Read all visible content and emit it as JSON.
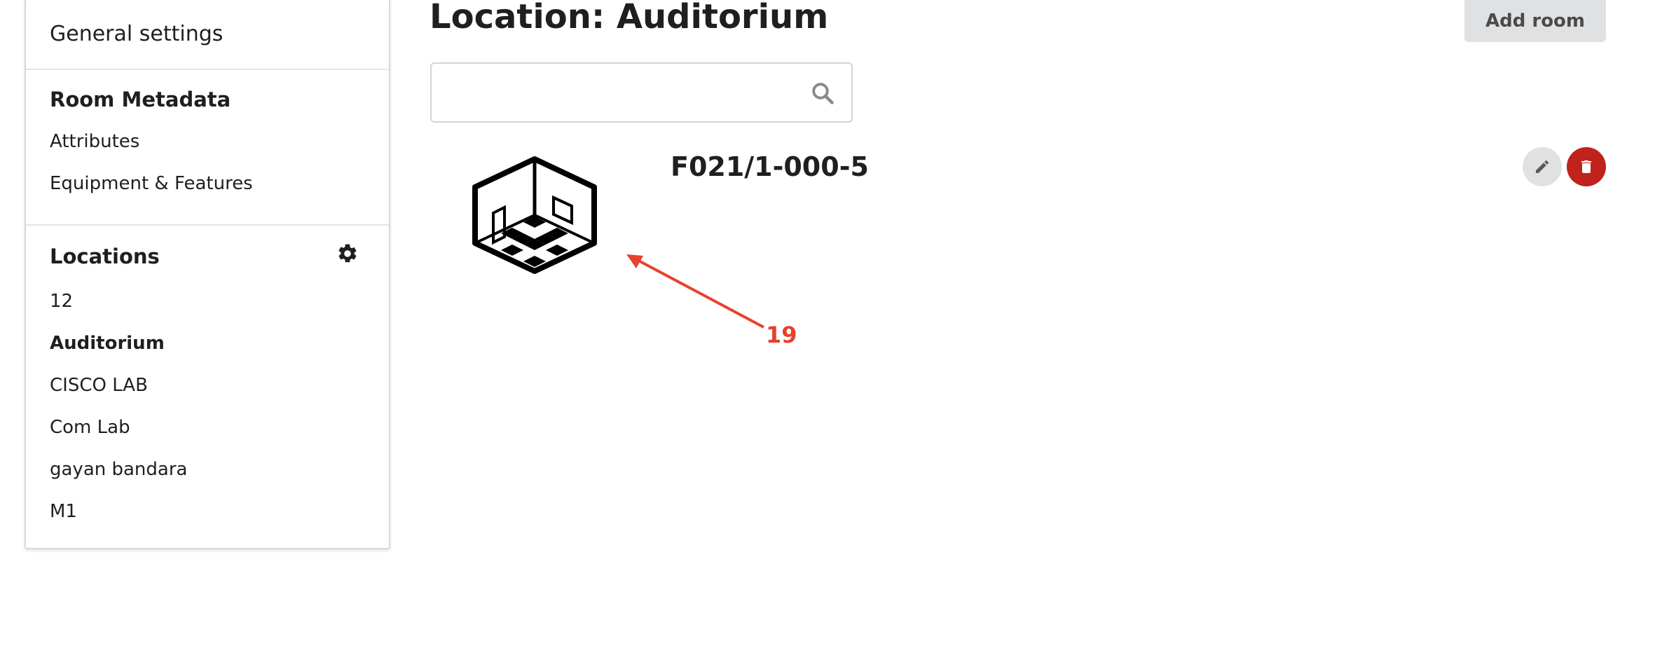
{
  "sidebar": {
    "general_settings_label": "General settings",
    "room_metadata": {
      "heading": "Room Metadata",
      "items": [
        {
          "label": "Attributes"
        },
        {
          "label": "Equipment & Features"
        }
      ]
    },
    "locations": {
      "heading": "Locations",
      "settings_icon": "gear-icon",
      "items": [
        {
          "label": "12",
          "active": false
        },
        {
          "label": "Auditorium",
          "active": true
        },
        {
          "label": "CISCO LAB",
          "active": false
        },
        {
          "label": "Com Lab",
          "active": false
        },
        {
          "label": "gayan bandara",
          "active": false
        },
        {
          "label": "M1",
          "active": false
        }
      ]
    }
  },
  "header": {
    "title": "Location: Auditorium",
    "add_room_label": "Add room"
  },
  "search": {
    "value": "",
    "placeholder": "",
    "icon": "search-icon"
  },
  "rooms": [
    {
      "name": "F021/1-000-5",
      "image_icon": "room-icon",
      "edit_icon": "pencil-icon",
      "delete_icon": "trash-icon"
    }
  ],
  "annotation": {
    "label": "19",
    "color": "#e8412c"
  },
  "colors": {
    "delete": "#c0221c",
    "button_grey": "#e0e1e2",
    "text": "#1f1f1f"
  }
}
